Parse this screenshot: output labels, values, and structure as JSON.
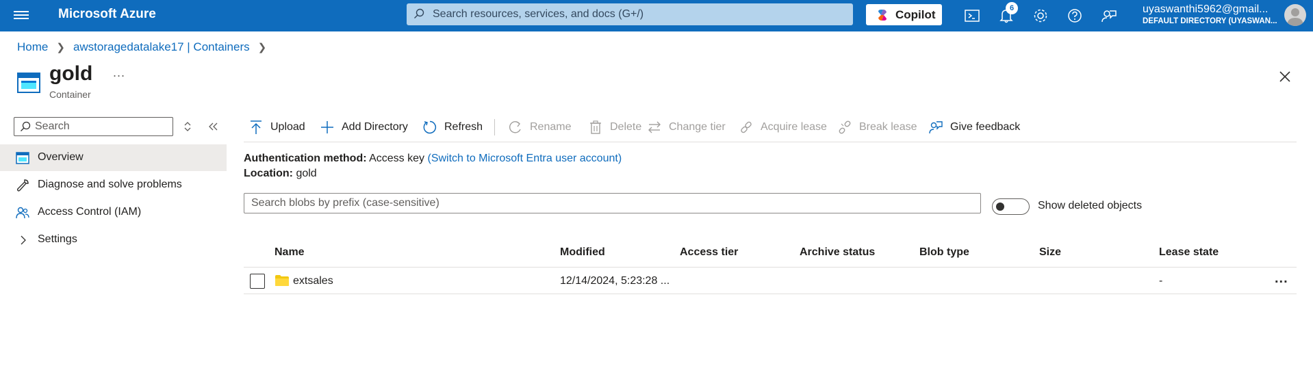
{
  "topbar": {
    "brand": "Microsoft Azure",
    "search_placeholder": "Search resources, services, and docs (G+/)",
    "copilot_label": "Copilot",
    "notifications_count": "6",
    "account_name": "uyaswanthi5962@gmail...",
    "account_directory": "DEFAULT DIRECTORY (UYASWAN..."
  },
  "breadcrumb": {
    "items": [
      "Home",
      "awstoragedatalake17 | Containers"
    ]
  },
  "header": {
    "title": "gold",
    "subtitle": "Container",
    "more": "..."
  },
  "sidebar": {
    "search_placeholder": "Search",
    "items": [
      {
        "label": "Overview",
        "icon": "container-icon",
        "active": true
      },
      {
        "label": "Diagnose and solve problems",
        "icon": "wrench-icon"
      },
      {
        "label": "Access Control (IAM)",
        "icon": "people-icon"
      },
      {
        "label": "Settings",
        "icon": "chevron-right-icon"
      }
    ]
  },
  "toolbar": {
    "upload": "Upload",
    "add_directory": "Add Directory",
    "refresh": "Refresh",
    "rename": "Rename",
    "delete": "Delete",
    "change_tier": "Change tier",
    "acquire_lease": "Acquire lease",
    "break_lease": "Break lease",
    "give_feedback": "Give feedback"
  },
  "info": {
    "auth_label": "Authentication method:",
    "auth_value": "Access key",
    "auth_link": "(Switch to Microsoft Entra user account)",
    "location_label": "Location:",
    "location_value": "gold"
  },
  "blob_search": {
    "placeholder": "Search blobs by prefix (case-sensitive)",
    "show_deleted_label": "Show deleted objects",
    "show_deleted": false
  },
  "table": {
    "columns": [
      "Name",
      "Modified",
      "Access tier",
      "Archive status",
      "Blob type",
      "Size",
      "Lease state"
    ],
    "rows": [
      {
        "name": "extsales",
        "modified": "12/14/2024, 5:23:28 ...",
        "access_tier": "",
        "archive_status": "",
        "blob_type": "",
        "size": "",
        "lease_state": "-",
        "more": "..."
      }
    ]
  },
  "colors": {
    "accent": "#0f6cbd",
    "folder": "#f2c811"
  }
}
